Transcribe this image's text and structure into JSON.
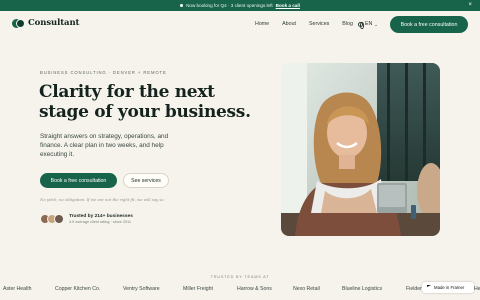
{
  "announcement": {
    "text": "Now booking for Q4 · 3 client openings left",
    "link": "Book a call",
    "close": "×"
  },
  "nav": {
    "brand": "Consultant",
    "items": [
      "Home",
      "About",
      "Services",
      "Blog"
    ],
    "language": "EN",
    "cta": "Book a free consultation"
  },
  "hero": {
    "eyebrow": "BUSINESS CONSULTING · DENVER + REMOTE",
    "headline_line1": "Clarity for the next",
    "headline_line2": "stage of your business.",
    "subtitle": "Straight answers on strategy, operations, and finance. A clear plan in two weeks, and help executing it.",
    "primary_cta": "Book a free consultation",
    "secondary_cta": "See services",
    "fineprint": "No pitch, no obligation. If we are not the right fit, we will say so.",
    "trust_title": "Trusted by 214+ businesses",
    "trust_subtitle": "4.9 average client rating · since 2011"
  },
  "logos": {
    "label": "TRUSTED BY TEAMS AT",
    "items": [
      "Aster Health",
      "Copper Kitchen Co.",
      "Ventry Software",
      "Miller Freight",
      "Harrow & Sons",
      "Nexo Retail",
      "Blueline Logistics",
      "Fielder &",
      "He"
    ]
  },
  "framer_badge": "Made in Framer",
  "colors": {
    "brand_green": "#17644a",
    "background": "#f6f3ec"
  }
}
